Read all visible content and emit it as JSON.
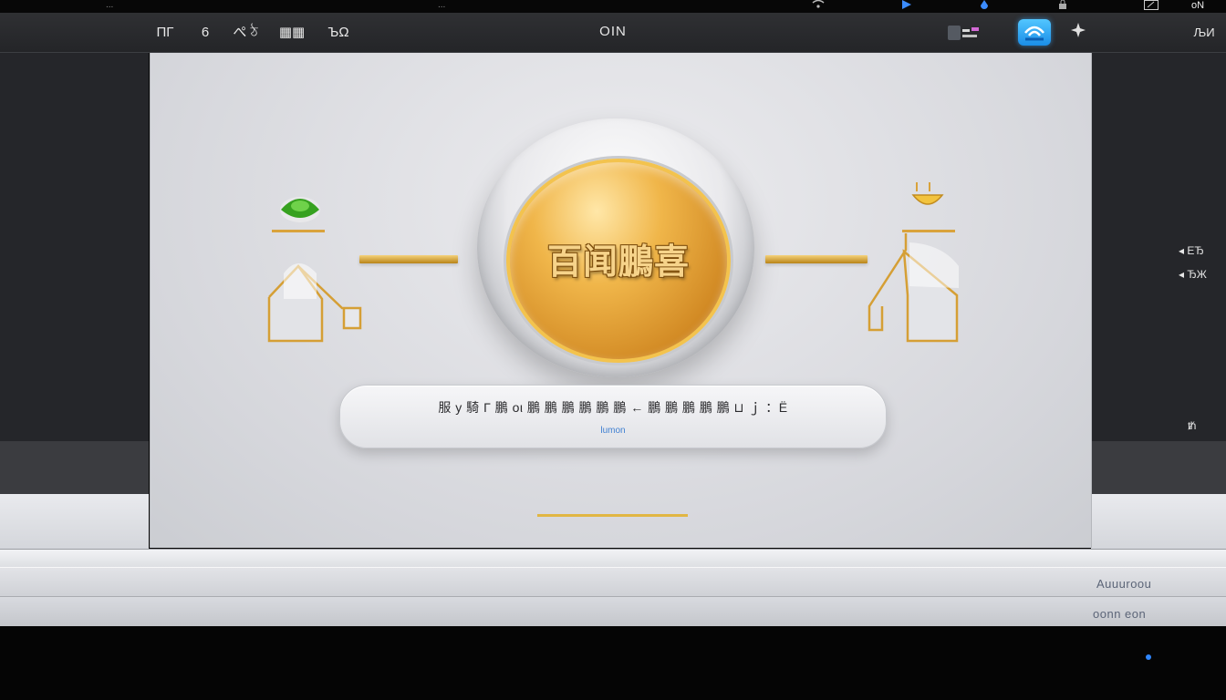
{
  "status_strip": {
    "left_text": "...",
    "center_text": "...",
    "right_text": "oN"
  },
  "toolbar": {
    "title": "OIN",
    "buttons": [
      {
        "label": "ΠΓ",
        "icon": "grid-icon"
      },
      {
        "label": "6",
        "icon": "refresh-icon"
      },
      {
        "label": "ぺ ঠ",
        "icon": "tools-icon"
      },
      {
        "label": "▦▦",
        "icon": "view-icon"
      },
      {
        "label": "ЪΩ",
        "icon": "layout-icon"
      }
    ],
    "right_label": "ЉИ"
  },
  "side_menu": {
    "items": [
      {
        "label": "ЕЂ"
      },
      {
        "label": "ЂЖ"
      }
    ],
    "bottom_label": "ᵺ"
  },
  "coin": {
    "text": "百闻鵬喜"
  },
  "info": {
    "main_text": "服 y 騎 Γ 鵬  οι 鵬 鵬 鵬 鵬  鵬 鵬  ← 鵬 鵬 鵬 鵬 鵬  ⊔  ｊ ：Ё",
    "link_text": "lumon"
  },
  "footer": {
    "line1": "Auuuroou",
    "line2": "oonn eon"
  },
  "colors": {
    "accent_blue": "#2e86ff",
    "gold": "#d4a02e",
    "green": "#3da324"
  }
}
